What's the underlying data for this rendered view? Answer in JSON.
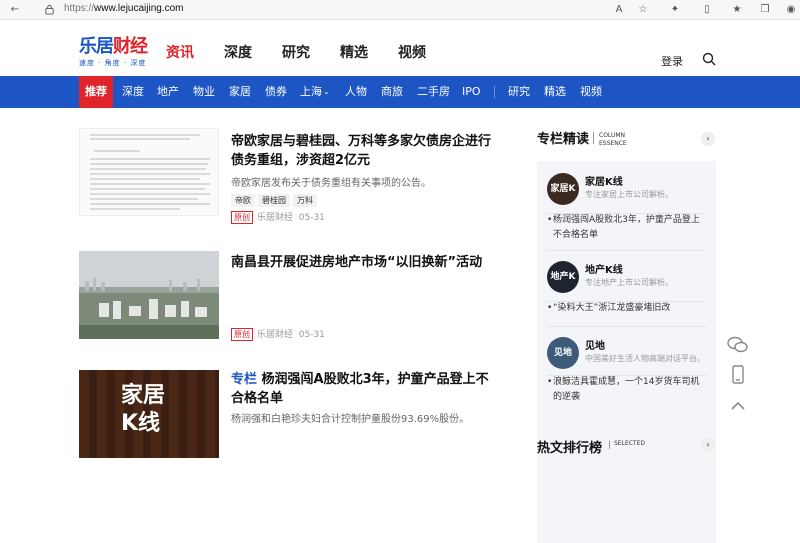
{
  "browser": {
    "url_prefix": "https://",
    "url_host": "www.lejucaijing.com"
  },
  "header": {
    "logo_text_a": "乐居",
    "logo_text_b": "财经",
    "logo_sub": "速度 · 角度 · 深度",
    "nav": [
      "资讯",
      "深度",
      "研究",
      "精选",
      "视频"
    ],
    "login": "登录"
  },
  "subnav": {
    "active": "推荐",
    "items": [
      "深度",
      "地产",
      "物业",
      "家居",
      "债券",
      "上海",
      "人物",
      "商旅",
      "二手房",
      "IPO",
      "研究",
      "精选",
      "视频"
    ]
  },
  "articles": [
    {
      "title": "帝欧家居与碧桂园、万科等多家欠债房企进行债务重组，涉资超2亿元",
      "desc": "帝欧家居发布关于债务重组有关事项的公告。",
      "tags": [
        "帝欧",
        "碧桂园",
        "万科"
      ],
      "badge": "原创",
      "source": "乐居财经",
      "date": "05-31"
    },
    {
      "title": "南昌县开展促进房地产市场“以旧换新”活动",
      "badge": "原创",
      "source": "乐居财经",
      "date": "05-31"
    },
    {
      "tag": "专栏",
      "title": "杨润强闯A股败北3年，护童产品登上不合格名单",
      "desc": "杨润强和白艳珍夫妇合计控制护童股份93.69%股份。",
      "thumb_text_a": "家居",
      "thumb_text_b": "K线"
    }
  ],
  "column": {
    "title": "专栏精读",
    "title_en": "COLUMN ESSENCE",
    "items": [
      {
        "name": "家居K线",
        "avatar": "家居K线",
        "sub": "专注家居上市公司解析。",
        "article": "杨润强闯A股败北3年，护童产品登上不合格名单"
      },
      {
        "name": "地产K线",
        "avatar": "地产K线",
        "sub": "专注地产上市公司解析。",
        "article": "“染料大王”浙江龙盛豪堵旧改"
      },
      {
        "name": "见地",
        "avatar": "见地",
        "sub": "中国美好生活人物高端对话平台。",
        "article": "浪鲸洁具霍成慧，一个14岁货车司机的逆袭"
      }
    ]
  },
  "hot": {
    "title": "热文排行榜",
    "title_en": "SELECTED"
  }
}
